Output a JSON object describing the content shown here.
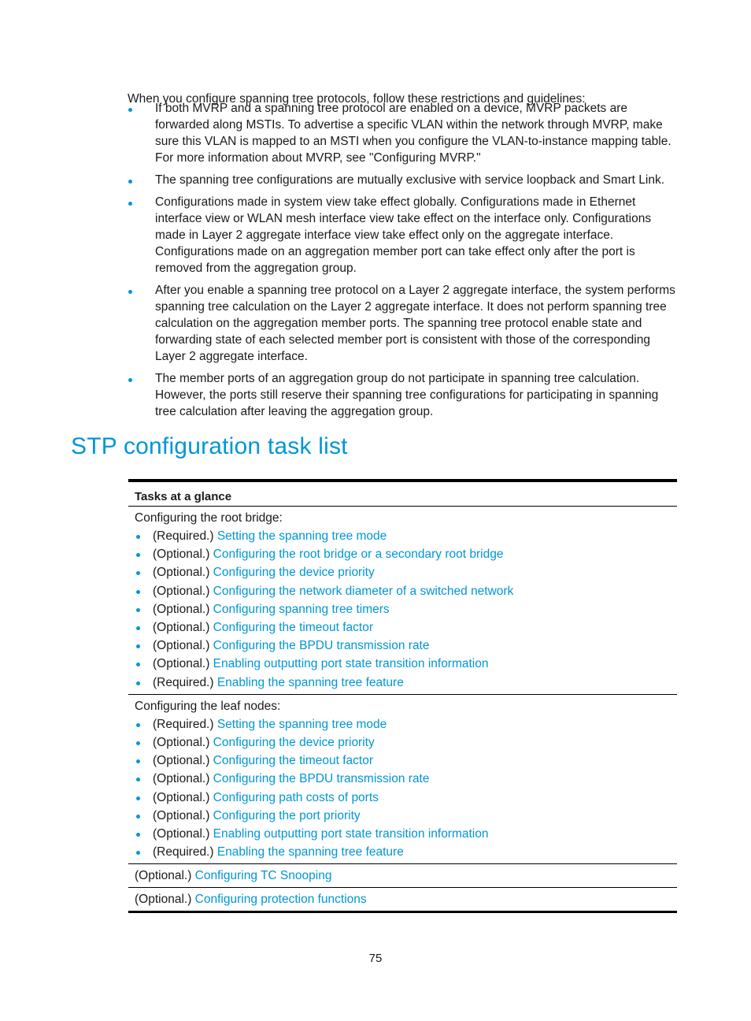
{
  "intro": "When you configure spanning tree protocols, follow these restrictions and guidelines:",
  "guidelines": [
    "If both MVRP and a spanning tree protocol are enabled on a device, MVRP packets are forwarded along MSTIs. To advertise a specific VLAN within the network through MVRP, make sure this VLAN is mapped to an MSTI when you configure the VLAN-to-instance mapping table. For more information about MVRP, see \"Configuring MVRP.\"",
    "The spanning tree configurations are mutually exclusive with service loopback and Smart Link.",
    "Configurations made in system view take effect globally. Configurations made in Ethernet interface view or WLAN mesh interface view take effect on the interface only. Configurations made in Layer 2 aggregate interface view take effect only on the aggregate interface. Configurations made on an aggregation member port can take effect only after the port is removed from the aggregation group.",
    "After you enable a spanning tree protocol on a Layer 2 aggregate interface, the system performs spanning tree calculation on the Layer 2 aggregate interface. It does not perform spanning tree calculation on the aggregation member ports. The spanning tree protocol enable state and forwarding state of each selected member port is consistent with those of the corresponding Layer 2 aggregate interface.",
    "The member ports of an aggregation group do not participate in spanning tree calculation. However, the ports still reserve their spanning tree configurations for participating in spanning tree calculation after leaving the aggregation group."
  ],
  "section_title": "STP configuration task list",
  "table": {
    "header": "Tasks at a glance",
    "root_bridge": {
      "heading": "Configuring the root bridge:",
      "tasks": [
        {
          "prefix": "(Required.) ",
          "link": "Setting the spanning tree mode"
        },
        {
          "prefix": "(Optional.) ",
          "link": "Configuring the root bridge or a secondary root bridge"
        },
        {
          "prefix": "(Optional.) ",
          "link": "Configuring the device priority"
        },
        {
          "prefix": "(Optional.) ",
          "link": "Configuring the network diameter of a switched network"
        },
        {
          "prefix": "(Optional.) ",
          "link": "Configuring spanning tree timers"
        },
        {
          "prefix": "(Optional.) ",
          "link": "Configuring the timeout factor"
        },
        {
          "prefix": "(Optional.) ",
          "link": "Configuring the BPDU transmission rate"
        },
        {
          "prefix": "(Optional.) ",
          "link": "Enabling outputting port state transition information"
        },
        {
          "prefix": "(Required.) ",
          "link": "Enabling the spanning tree feature"
        }
      ]
    },
    "leaf_nodes": {
      "heading": "Configuring the leaf nodes:",
      "tasks": [
        {
          "prefix": "(Required.) ",
          "link": "Setting the spanning tree mode"
        },
        {
          "prefix": "(Optional.) ",
          "link": "Configuring the device priority"
        },
        {
          "prefix": "(Optional.) ",
          "link": "Configuring the timeout factor"
        },
        {
          "prefix": "(Optional.) ",
          "link": "Configuring the BPDU transmission rate"
        },
        {
          "prefix": "(Optional.) ",
          "link": "Configuring path costs of ports"
        },
        {
          "prefix": "(Optional.) ",
          "link": "Configuring the port priority"
        },
        {
          "prefix": "(Optional.) ",
          "link": "Enabling outputting port state transition information"
        },
        {
          "prefix": "(Required.) ",
          "link": "Enabling the spanning tree feature"
        }
      ]
    },
    "tc_snooping": {
      "prefix": "(Optional.) ",
      "link": "Configuring TC Snooping"
    },
    "protection": {
      "prefix": "(Optional.) ",
      "link": "Configuring protection functions"
    }
  },
  "page_number": "75",
  "colors": {
    "accent": "#0096d6",
    "text": "#1a1a1a"
  }
}
